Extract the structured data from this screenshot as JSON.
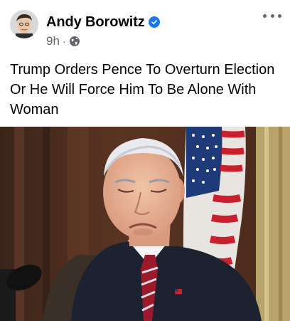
{
  "post": {
    "author_name": "Andy Borowitz",
    "verified": true,
    "timestamp": "9h",
    "separator": "·",
    "audience_icon": "globe-icon",
    "more_icon": "more-options-icon",
    "text": "Trump Orders Pence To Overturn Election Or He Will Force Him To Be Alone With Woman"
  },
  "colors": {
    "verified_badge": "#1877f2",
    "secondary_text": "#65676b",
    "primary_text": "#050505"
  }
}
